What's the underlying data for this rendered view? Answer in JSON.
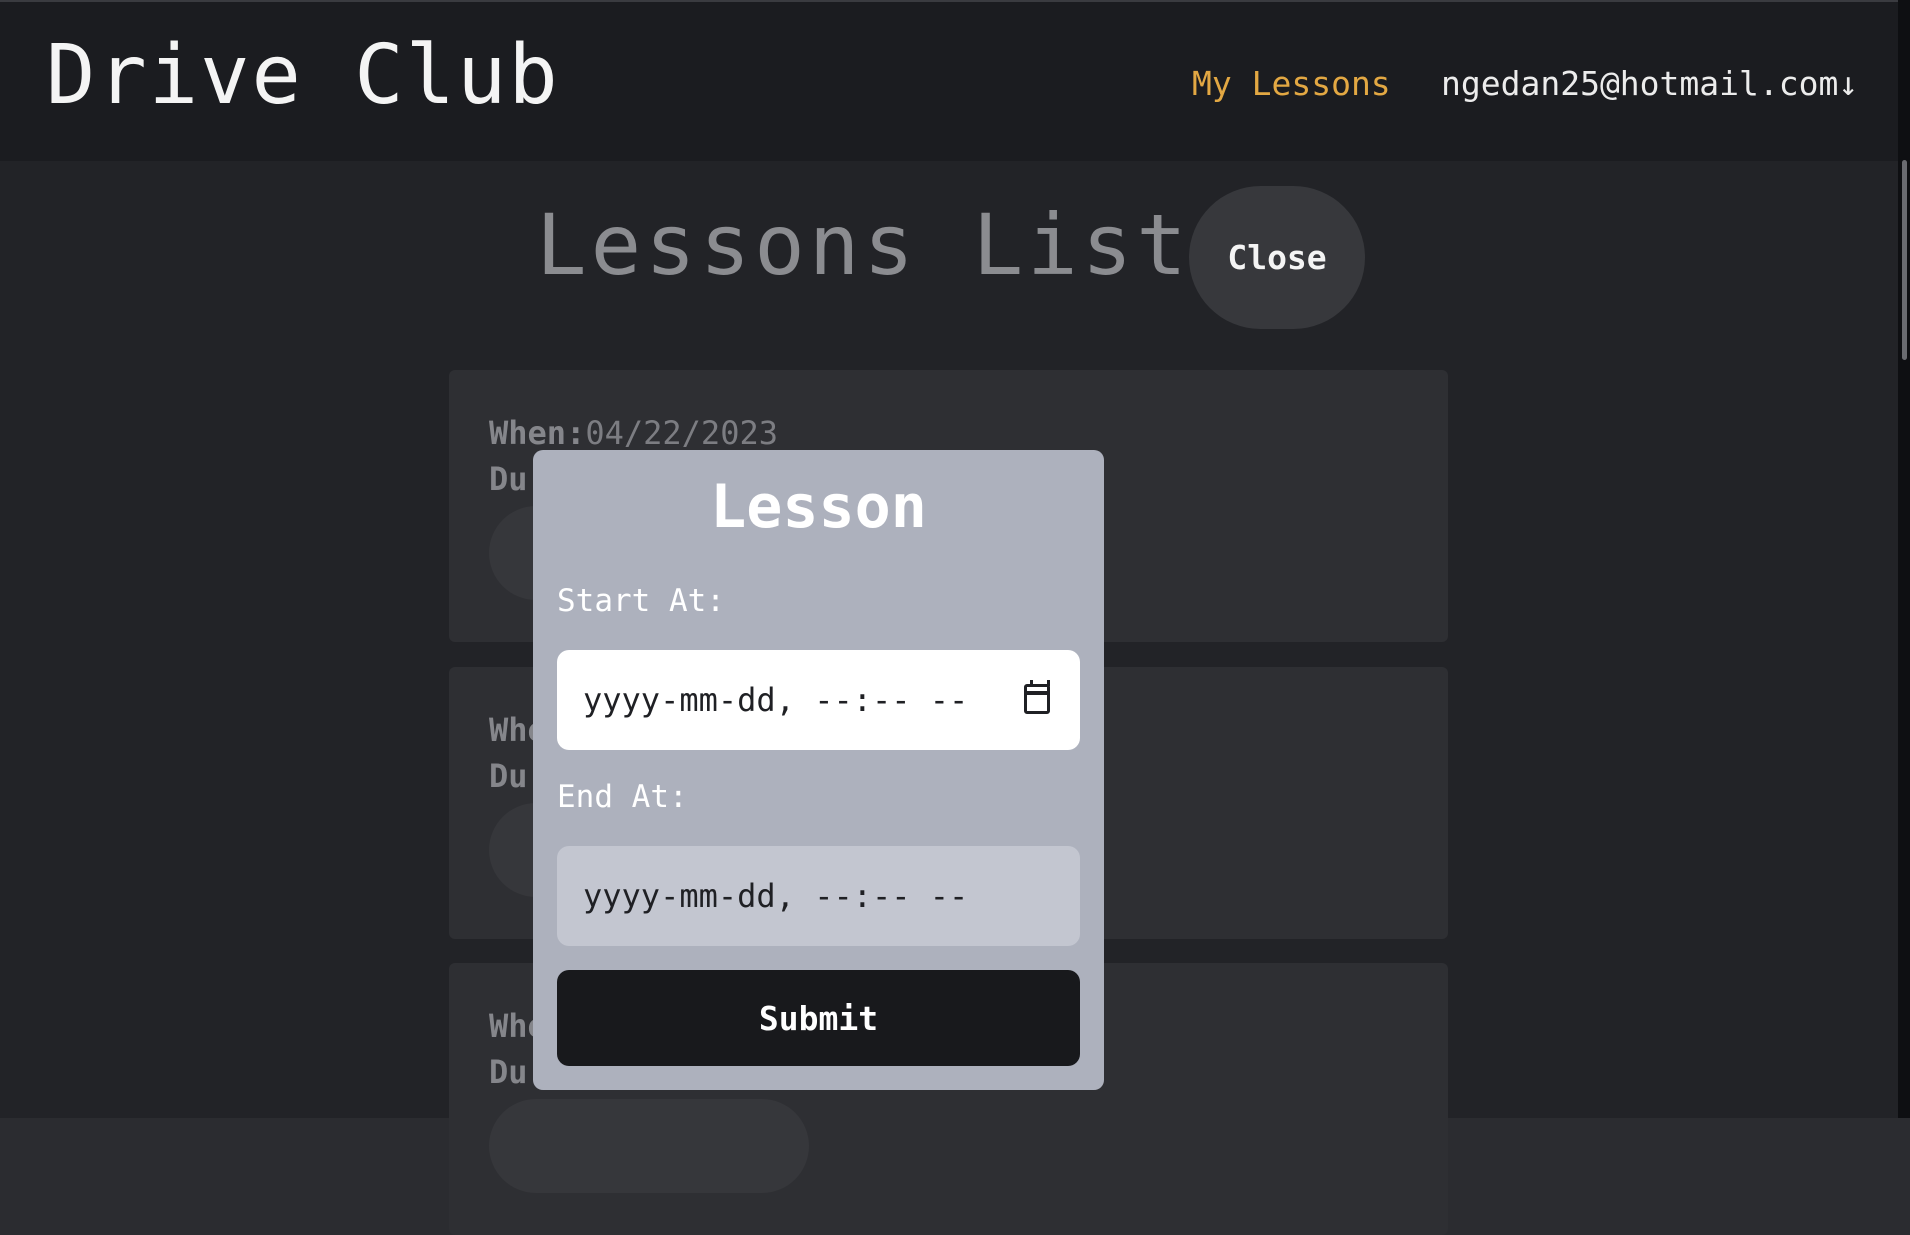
{
  "header": {
    "brand": "Drive Club",
    "nav_lessons": "My Lessons",
    "user_email": "ngedan25@hotmail.com",
    "user_menu_arrow": "↓"
  },
  "page": {
    "title": "Lessons List",
    "close_label": "Close"
  },
  "cards": [
    {
      "when_label": "When:",
      "when_value": "04/22/2023",
      "duration_label": "Du"
    },
    {
      "when_label": "Whe",
      "when_value": "",
      "duration_label": "Du"
    },
    {
      "when_label": "Whe",
      "when_value": "",
      "duration_label": "Du"
    }
  ],
  "modal": {
    "title": "Lesson",
    "start_label": "Start At:",
    "start_placeholder": "yyyy-mm-dd, --:-- --",
    "end_label": "End At:",
    "end_placeholder": "yyyy-mm-dd, --:-- --",
    "submit_label": "Submit",
    "calendar_icon": "calendar-icon"
  },
  "colors": {
    "accent": "#e3a843",
    "modal_bg": "#adb1bd",
    "topbar_bg": "#1b1c20"
  }
}
